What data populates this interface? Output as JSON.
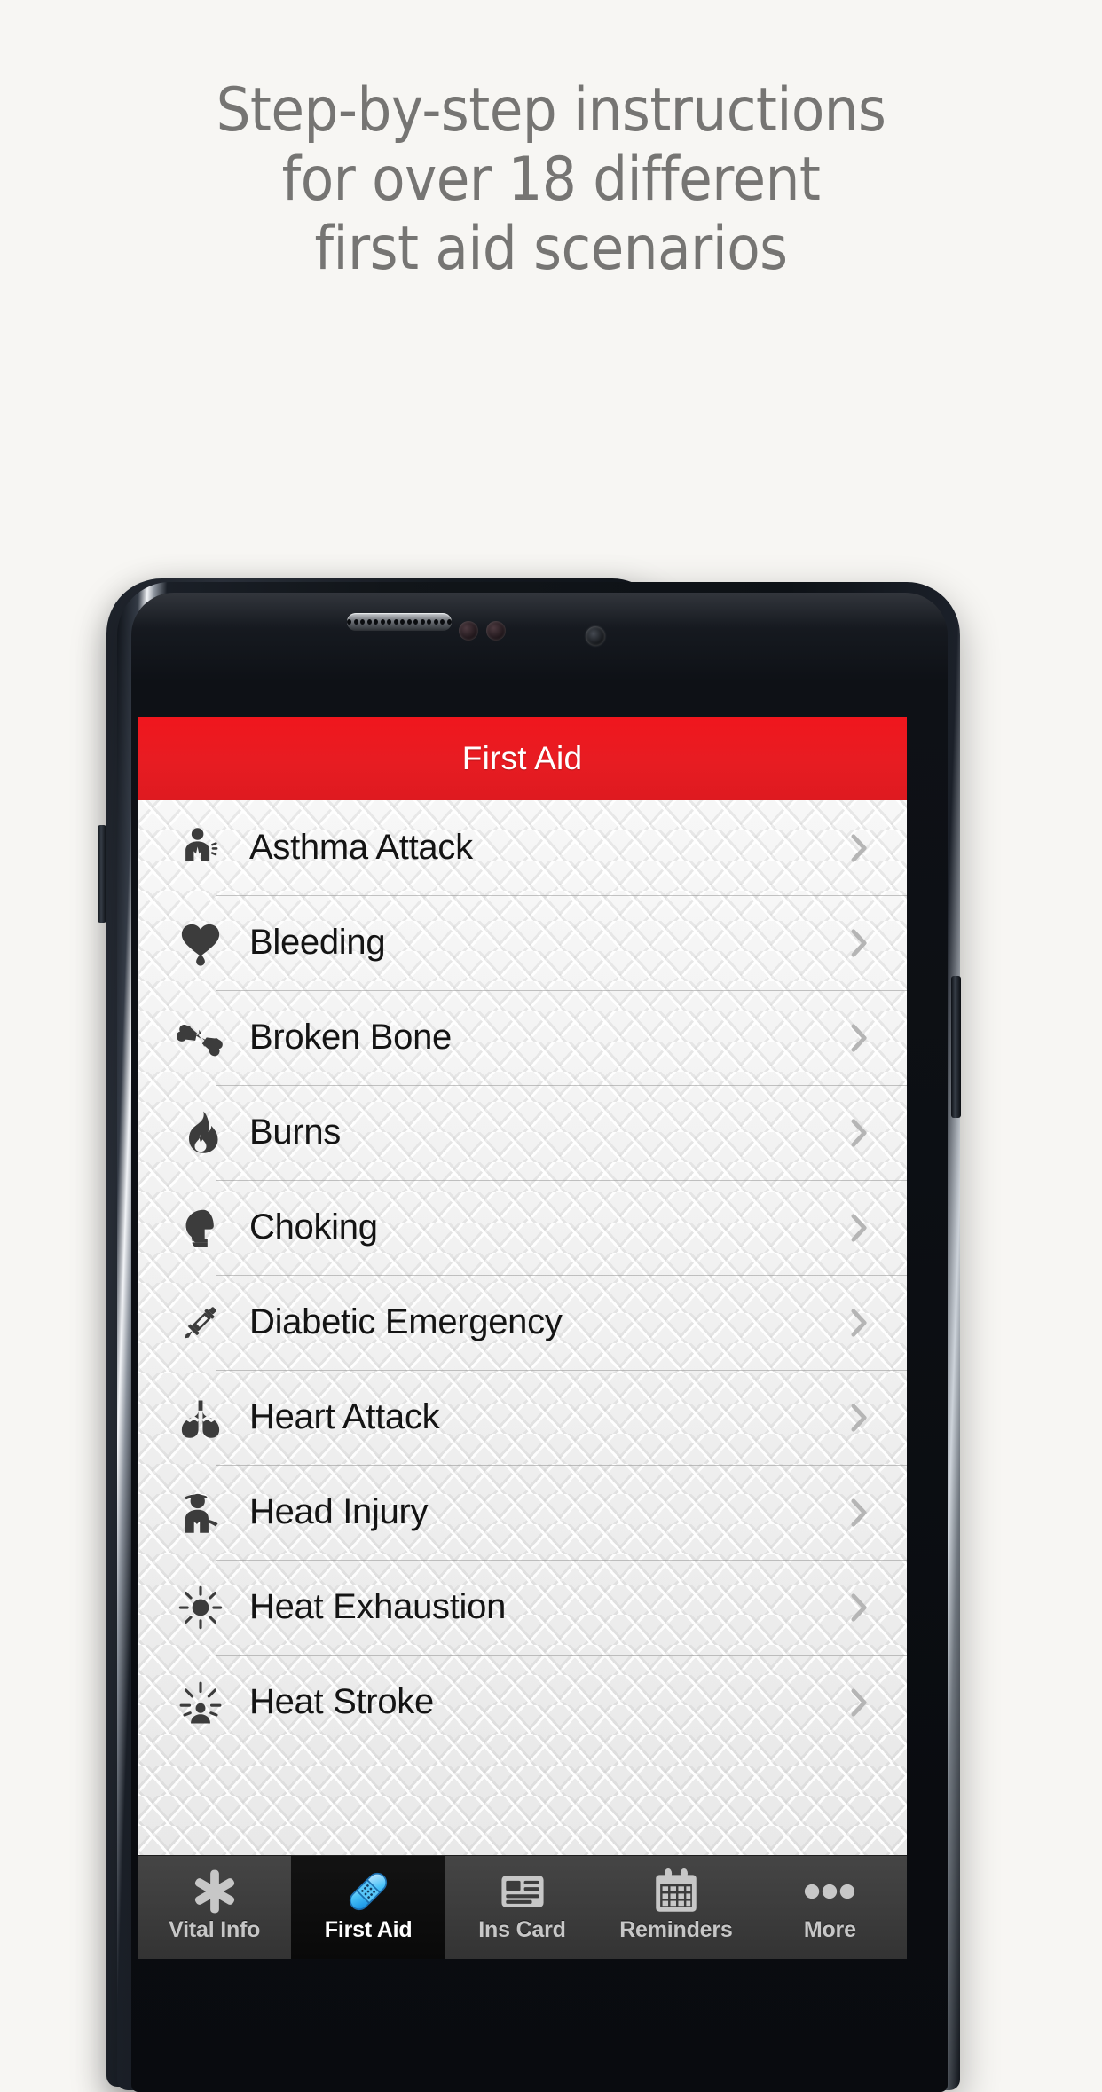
{
  "promo": {
    "headline_lines": [
      "Step-by-step instructions",
      "for over 18 different",
      "first aid scenarios"
    ],
    "headline_color": "#767573",
    "background_color": "#f7f6f3"
  },
  "device": {
    "hardware_name": "android-smartphone",
    "speaker_dot_count": 16
  },
  "app": {
    "nav": {
      "title": "First Aid",
      "bar_color": "#e81c22",
      "title_color": "#ffffff"
    },
    "list": {
      "items": [
        {
          "label": "Asthma Attack",
          "icon": "asthma-icon",
          "accessory": "chevron-right-icon"
        },
        {
          "label": "Bleeding",
          "icon": "heart-blood-drop-icon",
          "accessory": "chevron-right-icon"
        },
        {
          "label": "Broken Bone",
          "icon": "broken-bone-icon",
          "accessory": "chevron-right-icon"
        },
        {
          "label": "Burns",
          "icon": "flame-icon",
          "accessory": "chevron-right-icon"
        },
        {
          "label": "Choking",
          "icon": "choking-head-icon",
          "accessory": "chevron-right-icon"
        },
        {
          "label": "Diabetic Emergency",
          "icon": "syringe-icon",
          "accessory": "chevron-right-icon"
        },
        {
          "label": "Heart Attack",
          "icon": "lungs-icon",
          "accessory": "chevron-right-icon"
        },
        {
          "label": "Head Injury",
          "icon": "head-injury-icon",
          "accessory": "chevron-right-icon"
        },
        {
          "label": "Heat Exhaustion",
          "icon": "sun-icon",
          "accessory": "chevron-right-icon"
        },
        {
          "label": "Heat Stroke",
          "icon": "sun-person-icon",
          "accessory": "chevron-right-icon"
        }
      ]
    },
    "tabbar": {
      "selected": "First Aid",
      "tabs": [
        {
          "label": "Vital Info",
          "icon": "star-of-life-icon",
          "active": false
        },
        {
          "label": "First Aid",
          "icon": "bandage-icon",
          "active": true
        },
        {
          "label": "Ins Card",
          "icon": "id-card-icon",
          "active": false
        },
        {
          "label": "Reminders",
          "icon": "calendar-icon",
          "active": false
        },
        {
          "label": "More",
          "icon": "ellipsis-icon",
          "active": false
        }
      ],
      "inactive_color": "#c7c7c7",
      "active_color": "#ffffff",
      "bandage_color": "#2ea8ec"
    }
  }
}
